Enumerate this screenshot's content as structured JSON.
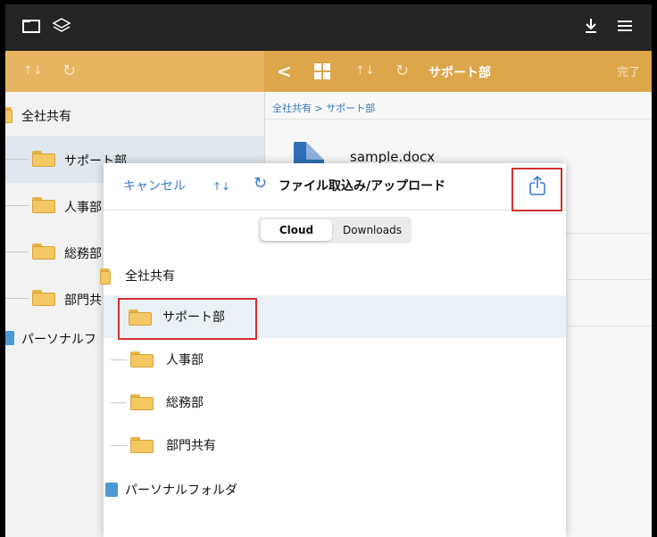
{
  "topbar": {
    "left_icons": [
      "folder-icon",
      "layers-icon"
    ],
    "right_icons": [
      "download-icon",
      "menu-icon"
    ]
  },
  "toolbar_left": {
    "sort_glyph": "↑↓",
    "refresh_glyph": "↻"
  },
  "toolbar_right": {
    "back_glyph": "<",
    "title": "サポート部",
    "done_label": "完了"
  },
  "left_tree": {
    "root": "全社共有",
    "items": [
      {
        "label": "サポート部",
        "selected": true
      },
      {
        "label": "人事部"
      },
      {
        "label": "総務部"
      },
      {
        "label": "部門共"
      }
    ],
    "personal": "パーソナルフ"
  },
  "right_pane": {
    "breadcrumb": "全社共有 > サポート部",
    "file": {
      "name": "sample.docx"
    }
  },
  "modal": {
    "cancel_label": "キャンセル",
    "title": "ファイル取込み/アップロード",
    "tabs": [
      {
        "label": "Cloud",
        "active": true
      },
      {
        "label": "Downloads",
        "active": false
      }
    ],
    "tree": {
      "root": "全社共有",
      "items": [
        {
          "label": "サポート部",
          "selected": true
        },
        {
          "label": "人事部"
        },
        {
          "label": "総務部"
        },
        {
          "label": "部門共有"
        }
      ],
      "personal": "パーソナルフォルダ"
    }
  },
  "colors": {
    "orange": "#dda64a",
    "accent_blue": "#3a7bd5",
    "highlight_red": "#d3302f"
  }
}
